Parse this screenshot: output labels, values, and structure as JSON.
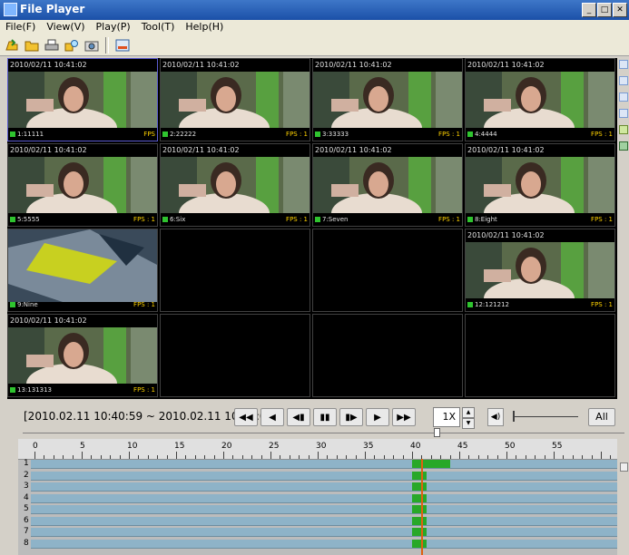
{
  "window": {
    "title": "File Player"
  },
  "menu": [
    {
      "label": "File(F)"
    },
    {
      "label": "View(V)"
    },
    {
      "label": "Play(P)"
    },
    {
      "label": "Tool(T)"
    },
    {
      "label": "Help(H)"
    }
  ],
  "toolbar": [
    {
      "icon": "open-icon"
    },
    {
      "icon": "folder-icon"
    },
    {
      "icon": "print-icon"
    },
    {
      "icon": "search-icon"
    },
    {
      "icon": "snapshot-icon"
    },
    {
      "icon": "export-icon"
    }
  ],
  "cells": [
    {
      "row": 0,
      "col": 0,
      "timestamp": "2010/02/11 10:41:02",
      "channel": "1:11111",
      "fps": "FPS",
      "video": "person",
      "selected": true
    },
    {
      "row": 0,
      "col": 1,
      "timestamp": "2010/02/11 10:41:02",
      "channel": "2:22222",
      "fps": "FPS : 1",
      "video": "person",
      "selected": false
    },
    {
      "row": 0,
      "col": 2,
      "timestamp": "2010/02/11 10:41:02",
      "channel": "3:33333",
      "fps": "FPS : 1",
      "video": "person",
      "selected": false
    },
    {
      "row": 0,
      "col": 3,
      "timestamp": "2010/02/11 10:41:02",
      "channel": "4:4444",
      "fps": "FPS : 1",
      "video": "person",
      "selected": false
    },
    {
      "row": 1,
      "col": 0,
      "timestamp": "2010/02/11 10:41:02",
      "channel": "5:5555",
      "fps": "FPS : 1",
      "video": "person",
      "selected": false
    },
    {
      "row": 1,
      "col": 1,
      "timestamp": "2010/02/11 10:41:02",
      "channel": "6:Six",
      "fps": "FPS : 1",
      "video": "person",
      "selected": false
    },
    {
      "row": 1,
      "col": 2,
      "timestamp": "2010/02/11 10:41:02",
      "channel": "7:Seven",
      "fps": "FPS : 1",
      "video": "person",
      "selected": false
    },
    {
      "row": 1,
      "col": 3,
      "timestamp": "2010/02/11 10:41:02",
      "channel": "8:Eight",
      "fps": "FPS : 1",
      "video": "person",
      "selected": false
    },
    {
      "row": 2,
      "col": 0,
      "timestamp": "2010/02/11 10:41:02",
      "channel": "9:Nine",
      "fps": "FPS : 1",
      "video": "object",
      "selected": false
    },
    {
      "row": 2,
      "col": 1,
      "timestamp": "",
      "channel": "",
      "fps": "",
      "video": "none",
      "selected": false
    },
    {
      "row": 2,
      "col": 2,
      "timestamp": "",
      "channel": "",
      "fps": "",
      "video": "none",
      "selected": false
    },
    {
      "row": 2,
      "col": 3,
      "timestamp": "2010/02/11 10:41:02",
      "channel": "12:121212",
      "fps": "FPS : 1",
      "video": "person",
      "selected": false
    },
    {
      "row": 3,
      "col": 0,
      "timestamp": "2010/02/11 10:41:02",
      "channel": "13:131313",
      "fps": "FPS : 1",
      "video": "person",
      "selected": false
    },
    {
      "row": 3,
      "col": 1,
      "timestamp": "",
      "channel": "",
      "fps": "",
      "video": "none",
      "selected": false
    },
    {
      "row": 3,
      "col": 2,
      "timestamp": "",
      "channel": "",
      "fps": "",
      "video": "none",
      "selected": false
    },
    {
      "row": 3,
      "col": 3,
      "timestamp": "",
      "channel": "",
      "fps": "",
      "video": "none",
      "selected": false
    }
  ],
  "controls": {
    "range": "[2010.02.11 10:40:59 ~ 2010.02.11 10:43:02]",
    "buttons": [
      {
        "name": "fast-rewind-button",
        "glyph": "◀◀"
      },
      {
        "name": "play-reverse-button",
        "glyph": "◀"
      },
      {
        "name": "step-back-button",
        "glyph": "◀▮"
      },
      {
        "name": "pause-button",
        "glyph": "▮▮"
      },
      {
        "name": "step-forward-button",
        "glyph": "▮▶"
      },
      {
        "name": "play-button",
        "glyph": "▶"
      },
      {
        "name": "fast-forward-button",
        "glyph": "▶▶"
      }
    ],
    "speed": "1X",
    "volume_glyph": "◀)",
    "all_label": "All"
  },
  "timeline": {
    "ticks": [
      "0",
      "5",
      "10",
      "15",
      "20",
      "25",
      "30",
      "35",
      "40",
      "45",
      "50",
      "55"
    ],
    "rows": [
      {
        "label": "1",
        "segments": [
          [
            40,
            44
          ]
        ]
      },
      {
        "label": "2",
        "segments": [
          [
            40,
            41.5
          ]
        ]
      },
      {
        "label": "3",
        "segments": [
          [
            40,
            41.5
          ]
        ]
      },
      {
        "label": "4",
        "segments": [
          [
            40,
            41.5
          ]
        ]
      },
      {
        "label": "5",
        "segments": [
          [
            40,
            41.5
          ]
        ]
      },
      {
        "label": "6",
        "segments": [
          [
            40,
            41.5
          ]
        ]
      },
      {
        "label": "7",
        "segments": [
          [
            40,
            41.5
          ]
        ]
      },
      {
        "label": "8",
        "segments": [
          [
            40,
            41.5
          ]
        ]
      }
    ],
    "cursor": 41
  },
  "colors": {
    "accent": "#1b50a8",
    "segment": "#28a828",
    "track": "#8eb3c8",
    "cursor": "#e06010",
    "fps": "#ffd200"
  }
}
